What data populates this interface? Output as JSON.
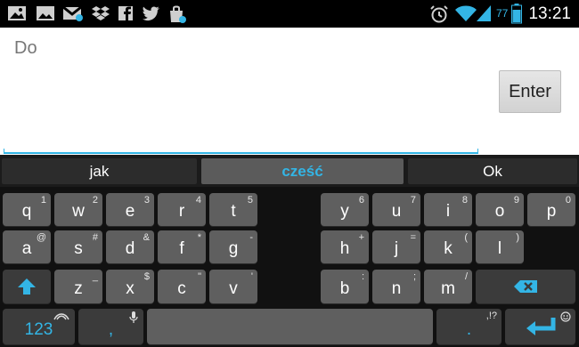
{
  "status_bar": {
    "time": "13:21",
    "battery_percent": "77",
    "icons": [
      "image-icon",
      "gmail-icon",
      "dropbox-icon",
      "facebook-icon",
      "twitter-icon",
      "store-icon",
      "alarm-icon",
      "wifi-icon",
      "signal-icon",
      "battery-icon"
    ]
  },
  "input": {
    "text": "Do",
    "enter_label": "Enter"
  },
  "suggestions": [
    "jak",
    "cześć",
    "Ok"
  ],
  "rows": [
    [
      {
        "k": "q",
        "s": "1"
      },
      {
        "k": "w",
        "s": "2"
      },
      {
        "k": "e",
        "s": "3"
      },
      {
        "k": "r",
        "s": "4"
      },
      {
        "k": "t",
        "s": "5"
      },
      {
        "k": "y",
        "s": "6"
      },
      {
        "k": "u",
        "s": "7"
      },
      {
        "k": "i",
        "s": "8"
      },
      {
        "k": "o",
        "s": "9"
      },
      {
        "k": "p",
        "s": "0"
      }
    ],
    [
      {
        "k": "a",
        "s": "@"
      },
      {
        "k": "s",
        "s": "#"
      },
      {
        "k": "d",
        "s": "&"
      },
      {
        "k": "f",
        "s": "*"
      },
      {
        "k": "g",
        "s": "-"
      },
      {
        "k": "h",
        "s": "+"
      },
      {
        "k": "j",
        "s": "="
      },
      {
        "k": "k",
        "s": "("
      },
      {
        "k": "l",
        "s": ")"
      }
    ],
    [
      {
        "k": "z",
        "s": "_"
      },
      {
        "k": "x",
        "s": "$"
      },
      {
        "k": "c",
        "s": "\""
      },
      {
        "k": "v",
        "s": "'"
      },
      {
        "k": "b",
        "s": ":"
      },
      {
        "k": "n",
        "s": ";"
      },
      {
        "k": "m",
        "s": "/"
      }
    ]
  ],
  "bottom_row": {
    "numbers_label": "123",
    "comma": ",",
    "period": ".",
    "period_sub": ",!?"
  },
  "colors": {
    "accent": "#33b5e5",
    "key": "#5f5f5f",
    "key_dark": "#3b3b3b"
  }
}
